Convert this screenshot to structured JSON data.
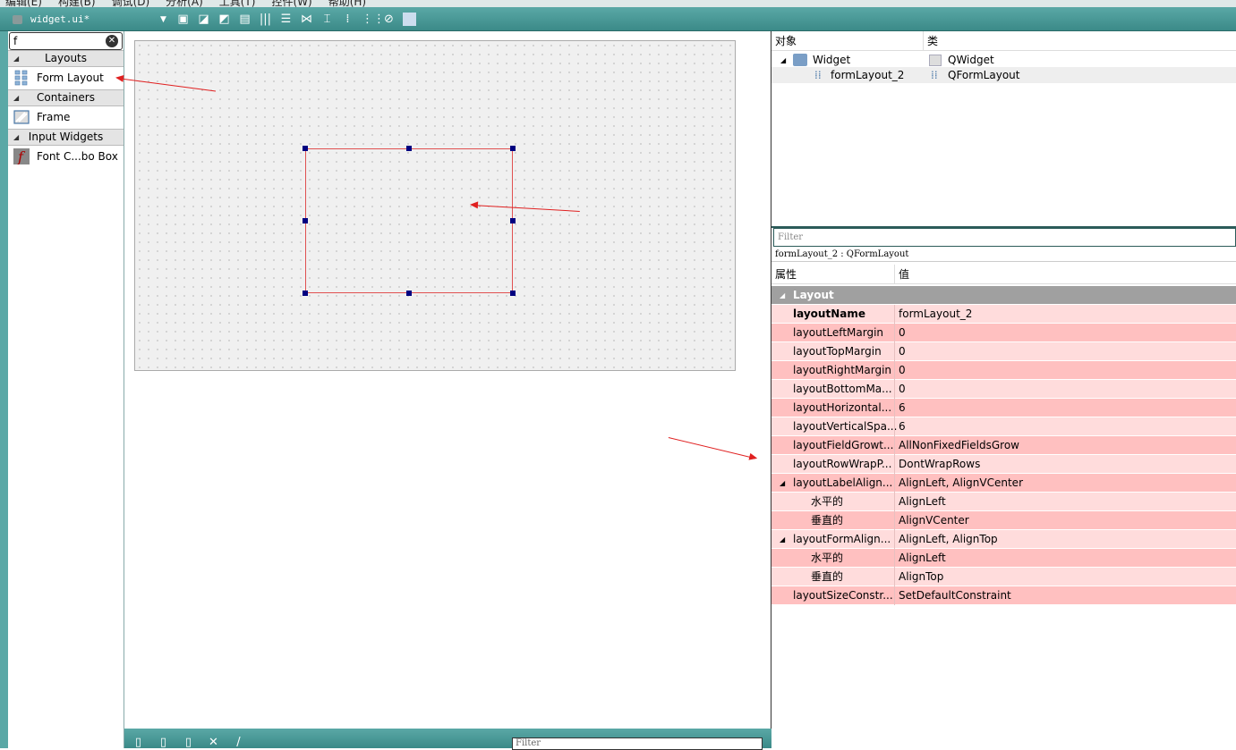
{
  "menubar": [
    "编辑(E)",
    "构建(B)",
    "调试(D)",
    "分析(A)",
    "工具(T)",
    "控件(W)",
    "帮助(H)"
  ],
  "editor": {
    "file_tab": "widget.ui*"
  },
  "widget_box": {
    "filter_value": "f",
    "categories": [
      {
        "label": "Layouts",
        "items": [
          {
            "label": "Form Layout",
            "icon": "form-layout-icon"
          }
        ]
      },
      {
        "label": "Containers",
        "items": [
          {
            "label": "Frame",
            "icon": "frame-icon"
          }
        ]
      },
      {
        "label": "Input Widgets",
        "items": [
          {
            "label": "Font C...bo Box",
            "icon": "font-combo-box-icon"
          }
        ]
      }
    ]
  },
  "bottom": {
    "filter_placeholder": "Filter"
  },
  "object_inspector": {
    "col_object": "对象",
    "col_class": "类",
    "rows": [
      {
        "object": "Widget",
        "class": "QWidget"
      },
      {
        "object": "formLayout_2",
        "class": "QFormLayout"
      }
    ]
  },
  "property_editor": {
    "filter_placeholder": "Filter",
    "object_class": "formLayout_2 : QFormLayout",
    "col_property": "属性",
    "col_value": "值",
    "group": "Layout",
    "rows": [
      {
        "name": "layoutName",
        "value": "formLayout_2"
      },
      {
        "name": "layoutLeftMargin",
        "value": "0"
      },
      {
        "name": "layoutTopMargin",
        "value": "0"
      },
      {
        "name": "layoutRightMargin",
        "value": "0"
      },
      {
        "name": "layoutBottomMa...",
        "value": "0"
      },
      {
        "name": "layoutHorizontal...",
        "value": "6"
      },
      {
        "name": "layoutVerticalSpa...",
        "value": "6"
      },
      {
        "name": "layoutFieldGrowt...",
        "value": "AllNonFixedFieldsGrow"
      },
      {
        "name": "layoutRowWrapP...",
        "value": "DontWrapRows"
      },
      {
        "name": "layoutLabelAlign...",
        "value": "AlignLeft, AlignVCenter"
      },
      {
        "name": "水平的",
        "value": "AlignLeft"
      },
      {
        "name": "垂直的",
        "value": "AlignVCenter"
      },
      {
        "name": "layoutFormAlign...",
        "value": "AlignLeft, AlignTop"
      },
      {
        "name": "水平的",
        "value": "AlignLeft"
      },
      {
        "name": "垂直的",
        "value": "AlignTop"
      },
      {
        "name": "layoutSizeConstr...",
        "value": "SetDefaultConstraint"
      }
    ]
  },
  "colors": {
    "toolbar": "#4a9a98",
    "row_light": "#ffdcdc",
    "row_dark": "#ffc0c0",
    "group": "#a0a0a0",
    "annotation": "#e02020",
    "handle": "#000080"
  }
}
